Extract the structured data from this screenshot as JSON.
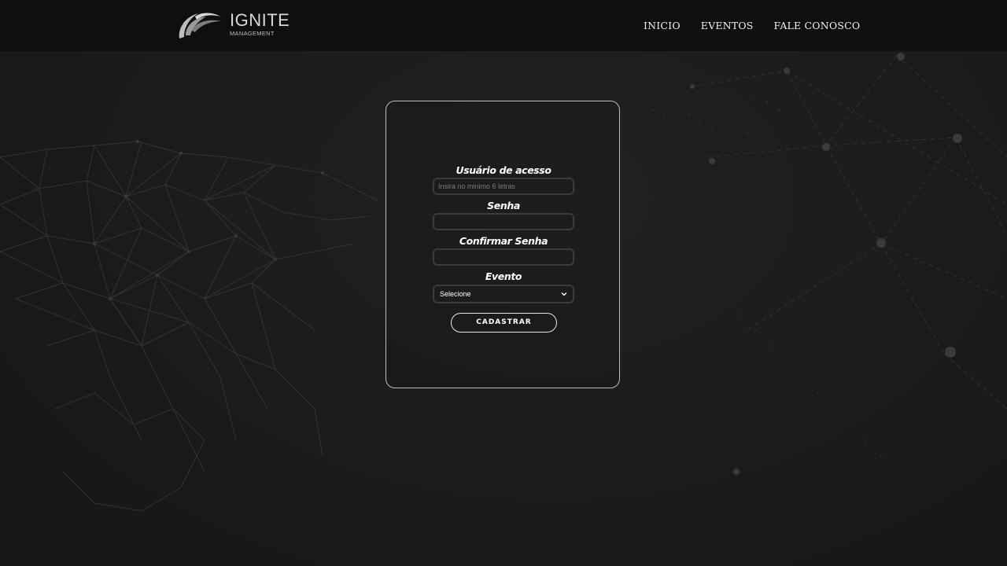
{
  "header": {
    "logo": {
      "title": "IGNITE",
      "subtitle": "MANAGEMENT"
    },
    "nav": [
      {
        "label": "INICIO"
      },
      {
        "label": "EVENTOS"
      },
      {
        "label": "FALE CONOSCO"
      }
    ]
  },
  "form": {
    "username": {
      "label": "Usuário de acesso",
      "placeholder": "Insira no minimo 6 letras",
      "value": ""
    },
    "password": {
      "label": "Senha",
      "value": ""
    },
    "confirm_password": {
      "label": "Confirmar Senha",
      "value": ""
    },
    "event": {
      "label": "Evento",
      "selected": "Selecione"
    },
    "submit_label": "CADASTRAR"
  },
  "colors": {
    "background": "#181919",
    "header": "#0f0f0f",
    "text": "#ffffff",
    "card_border": "#bdbdbd"
  },
  "icons": {
    "logo": "ignite-swoosh-logo",
    "select_arrow": "chevron-down-icon"
  }
}
